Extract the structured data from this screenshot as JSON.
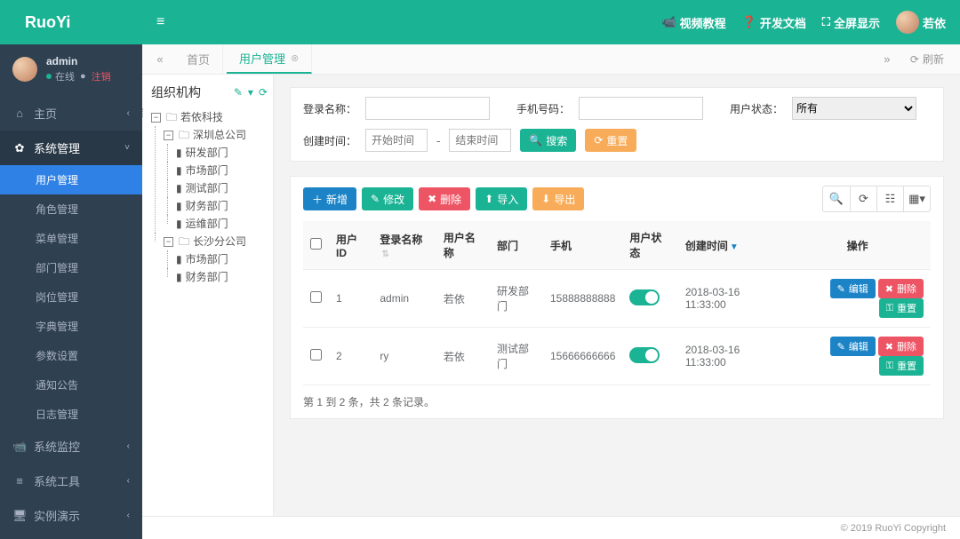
{
  "brand": "RuoYi",
  "user": {
    "name": "admin",
    "online": "在线",
    "logout": "注销"
  },
  "topbar": {
    "video": "视频教程",
    "docs": "开发文档",
    "fullscreen": "全屏显示",
    "profile": "若依"
  },
  "sidebar": {
    "home": "主页",
    "sys_mgmt": "系统管理",
    "sys_items": [
      "用户管理",
      "角色管理",
      "菜单管理",
      "部门管理",
      "岗位管理",
      "字典管理",
      "参数设置",
      "通知公告",
      "日志管理"
    ],
    "monitor": "系统监控",
    "tools": "系统工具",
    "demo": "实例演示"
  },
  "tabs": {
    "home": "首页",
    "users": "用户管理",
    "refresh": "刷新"
  },
  "tree": {
    "title": "组织机构",
    "root": "若依科技",
    "branch_sz": "深圳总公司",
    "sz_depts": [
      "研发部门",
      "市场部门",
      "测试部门",
      "财务部门",
      "运维部门"
    ],
    "branch_cs": "长沙分公司",
    "cs_depts": [
      "市场部门",
      "财务部门"
    ]
  },
  "search": {
    "login_label": "登录名称：",
    "phone_label": "手机号码：",
    "status_label": "用户状态：",
    "status_value": "所有",
    "create_label": "创建时间：",
    "start_ph": "开始时间",
    "end_ph": "结束时间",
    "search_btn": "搜索",
    "reset_btn": "重置"
  },
  "toolbar": {
    "add": "新增",
    "edit": "修改",
    "delete": "删除",
    "import": "导入",
    "export": "导出"
  },
  "table": {
    "headers": [
      "用户ID",
      "登录名称",
      "用户名称",
      "部门",
      "手机",
      "用户状态",
      "创建时间",
      "操作"
    ],
    "rows": [
      {
        "id": "1",
        "login": "admin",
        "name": "若依",
        "dept": "研发部门",
        "phone": "15888888888",
        "created": "2018-03-16 11:33:00"
      },
      {
        "id": "2",
        "login": "ry",
        "name": "若依",
        "dept": "测试部门",
        "phone": "15666666666",
        "created": "2018-03-16 11:33:00"
      }
    ],
    "actions": {
      "edit": "编辑",
      "delete": "删除",
      "reset": "重置"
    },
    "pagination": "第 1 到 2 条，共 2 条记录。"
  },
  "footer": "© 2019 RuoYi Copyright"
}
